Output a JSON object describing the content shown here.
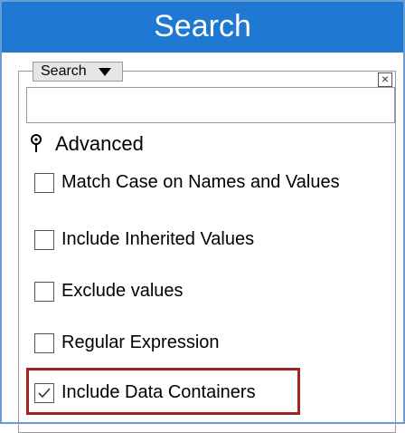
{
  "title": "Search",
  "search": {
    "scope_dropdown": "Search",
    "close_label": "×",
    "input_value": "",
    "input_placeholder": ""
  },
  "advanced": {
    "label": "Advanced",
    "icon": "pin-icon",
    "options": [
      {
        "label": "Match Case on Names and Values",
        "checked": false
      },
      {
        "label": "Include Inherited Values",
        "checked": false
      },
      {
        "label": "Exclude values",
        "checked": false
      },
      {
        "label": "Regular Expression",
        "checked": false
      },
      {
        "label": "Include Data Containers",
        "checked": true
      }
    ]
  },
  "colors": {
    "title_bar": "#1f78d1",
    "highlight": "#a32424"
  }
}
